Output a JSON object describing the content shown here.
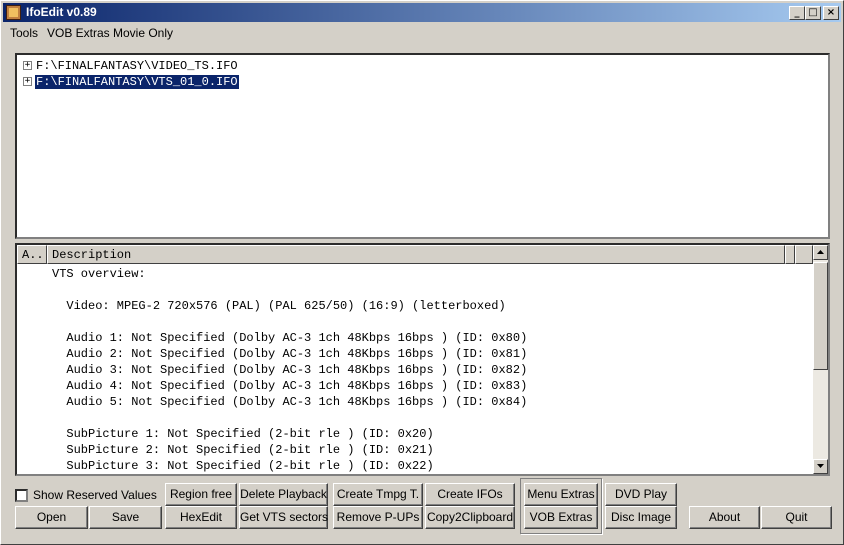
{
  "window": {
    "title": "IfoEdit v0.89"
  },
  "titlebar": {
    "minimize": "_",
    "maximize": "□",
    "close": "×"
  },
  "menu": {
    "items": [
      "Tools",
      "VOB Extras",
      "Movie Only"
    ]
  },
  "tree": {
    "nodes": [
      {
        "expander": "+",
        "label": "F:\\FINALFANTASY\\VIDEO_TS.IFO",
        "selected": false
      },
      {
        "expander": "+",
        "label": "F:\\FINALFANTASY\\VTS_01_0.IFO",
        "selected": true
      }
    ]
  },
  "grid": {
    "columns": [
      "A..",
      "Description"
    ],
    "lines": [
      "VTS overview:",
      "",
      "  Video: MPEG-2 720x576 (PAL) (PAL 625/50) (16:9) (letterboxed)",
      "",
      "  Audio 1: Not Specified (Dolby AC-3 1ch 48Kbps 16bps ) (ID: 0x80)",
      "  Audio 2: Not Specified (Dolby AC-3 1ch 48Kbps 16bps ) (ID: 0x81)",
      "  Audio 3: Not Specified (Dolby AC-3 1ch 48Kbps 16bps ) (ID: 0x82)",
      "  Audio 4: Not Specified (Dolby AC-3 1ch 48Kbps 16bps ) (ID: 0x83)",
      "  Audio 5: Not Specified (Dolby AC-3 1ch 48Kbps 16bps ) (ID: 0x84)",
      "",
      "  SubPicture 1: Not Specified (2-bit rle ) (ID: 0x20)",
      "  SubPicture 2: Not Specified (2-bit rle ) (ID: 0x21)",
      "  SubPicture 3: Not Specified (2-bit rle ) (ID: 0x22)"
    ]
  },
  "controls": {
    "show_reserved_label": "Show Reserved Values",
    "show_reserved_checked": false,
    "buttons": {
      "open": "Open",
      "save": "Save",
      "region_free": "Region free",
      "hexedit": "HexEdit",
      "delete_playback": "Delete Playback",
      "get_vts_sectors": "Get VTS sectors",
      "create_tmpg": "Create Tmpg T.",
      "remove_pups": "Remove P-UPs",
      "create_ifos": "Create IFOs",
      "copy2clipboard": "Copy2Clipboard",
      "menu_extras": "Menu Extras",
      "vob_extras": "VOB Extras",
      "dvd_play": "DVD Play",
      "disc_image": "Disc Image",
      "about": "About",
      "quit": "Quit"
    }
  },
  "icons": {
    "app": "ifoedit-app-icon",
    "expander": "tree-expander-icon",
    "scroll_up": "scroll-up-arrow-icon",
    "scroll_down": "scroll-down-arrow-icon"
  }
}
